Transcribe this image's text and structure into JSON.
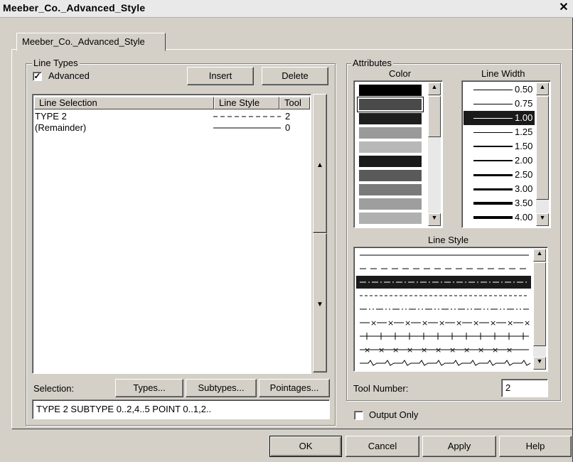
{
  "window": {
    "title": "Meeber_Co._Advanced_Style",
    "close": "✕"
  },
  "tab": {
    "label": "Meeber_Co._Advanced_Style"
  },
  "line_types": {
    "group_label": "Line Types",
    "advanced_label": "Advanced",
    "advanced_checked": true,
    "insert_label": "Insert",
    "delete_label": "Delete",
    "columns": [
      "Line Selection",
      "Line Style",
      "Tool"
    ],
    "rows": [
      {
        "selection": "TYPE 2",
        "style": "dashed",
        "tool": "2"
      },
      {
        "selection": "(Remainder)",
        "style": "solid",
        "tool": "0"
      }
    ],
    "selection_label": "Selection:",
    "types_label": "Types...",
    "subtypes_label": "Subtypes...",
    "pointages_label": "Pointages...",
    "selection_value": "TYPE 2 SUBTYPE 0..2,4..5 POINT 0..1,2.."
  },
  "attributes": {
    "group_label": "Attributes",
    "color_label": "Color",
    "colors": [
      "#000000",
      "#4a4a4a",
      "#1e1e1e",
      "#9a9a9a",
      "#b8b8b8",
      "#1a1a1a",
      "#5a5a5a",
      "#7a7a7a",
      "#9e9e9e",
      "#b0b0b0"
    ],
    "line_width_label": "Line Width",
    "line_widths": [
      "0.50",
      "0.75",
      "1.00",
      "1.25",
      "1.50",
      "2.00",
      "2.50",
      "3.00",
      "3.50",
      "4.00"
    ],
    "selected_width": "1.00",
    "line_style_label": "Line Style",
    "line_styles": [
      "solid",
      "dashed",
      "dash-dot",
      "dotted",
      "dash-dot-dot",
      "cross",
      "tick",
      "x-tick",
      "wave"
    ],
    "selected_style": "dash-dot",
    "tool_number_label": "Tool Number:",
    "tool_number_value": "2",
    "output_only_label": "Output Only",
    "output_only_checked": false
  },
  "buttons": {
    "ok": "OK",
    "cancel": "Cancel",
    "apply": "Apply",
    "help": "Help"
  }
}
